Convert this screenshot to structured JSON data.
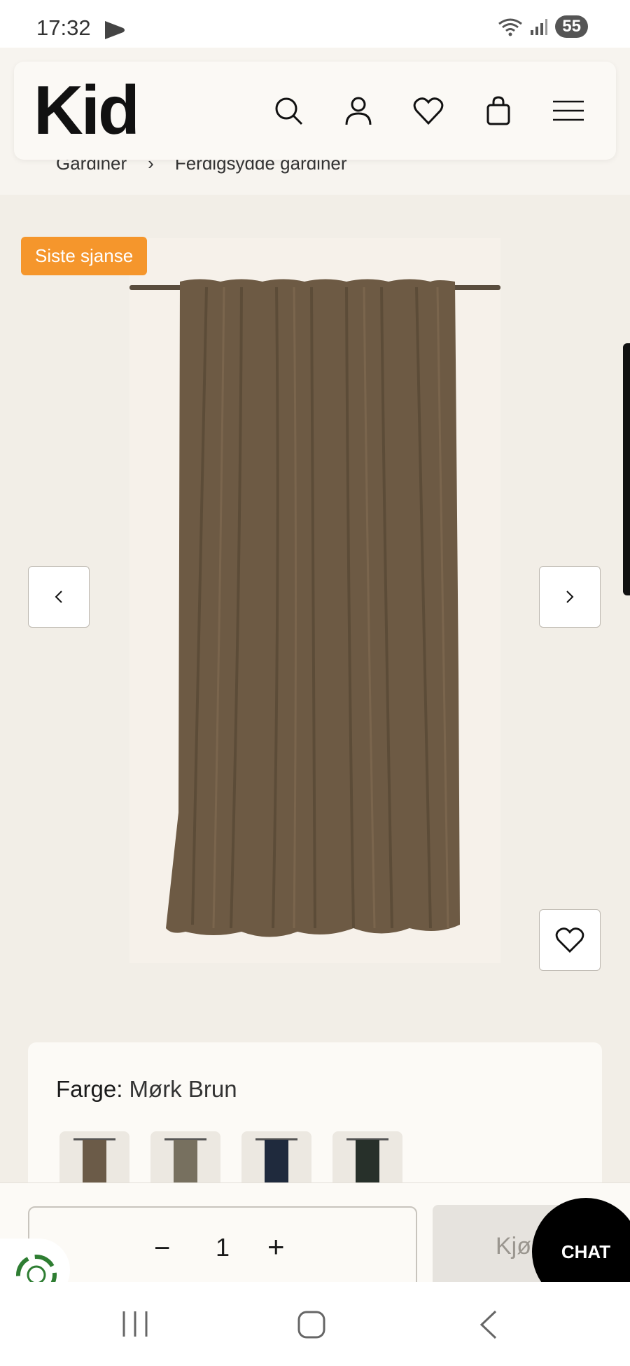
{
  "status_bar": {
    "time": "17:32",
    "battery": "55"
  },
  "header": {
    "logo": "Kid",
    "icons": [
      "search-icon",
      "account-icon",
      "heart-icon",
      "bag-icon",
      "menu-icon"
    ]
  },
  "breadcrumb": {
    "items": [
      "Gardiner",
      "Ferdigsydde gardiner"
    ],
    "separator": "›"
  },
  "product": {
    "badge": "Siste sjanse",
    "image_description": "brown velvet curtain",
    "color_label": "Farge:",
    "color_value": "Mørk Brun",
    "swatches": [
      {
        "name": "brown",
        "color": "#6b5b48"
      },
      {
        "name": "grey-brown",
        "color": "#77705f"
      },
      {
        "name": "navy",
        "color": "#1f2a3d"
      },
      {
        "name": "dark-green",
        "color": "#27302a"
      }
    ]
  },
  "purchase": {
    "quantity": "1",
    "minus": "−",
    "plus": "+",
    "buy_label": "Kjøp"
  },
  "chat": {
    "label": "CHAT"
  },
  "colors": {
    "badge": "#f5962c",
    "page_bg": "#f2eee7",
    "card_bg": "#fcfaf6"
  }
}
